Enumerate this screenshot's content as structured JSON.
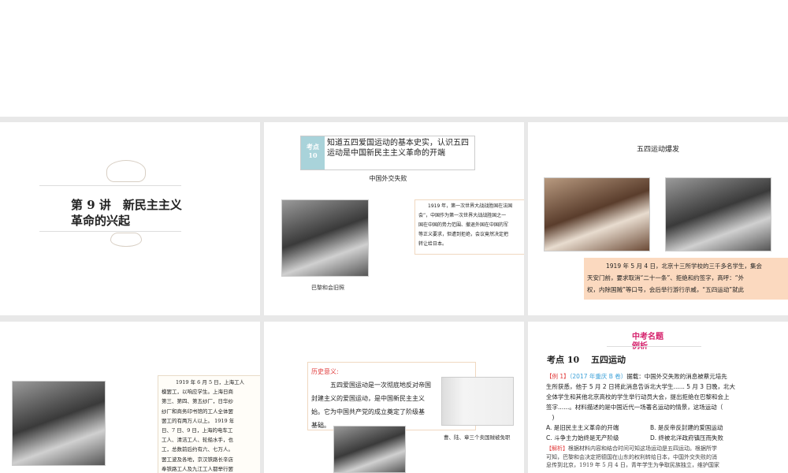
{
  "slides": [
    {
      "title_line1": "第 9 讲　新民主主义",
      "title_line2": "革命的兴起"
    },
    {
      "badge_top": "考点",
      "badge_num": "10",
      "objective": "知道五四爱国运动的基本史实，认识五四运动是中国新民主主义革命的开端",
      "heading": "中国外交失败",
      "photo_caption": "巴黎和会旧照",
      "text": [
        "1919 年，第一次世界大战战胜国在法国",
        "会”，中国作为第一次世界大战战胜国之一",
        "国在中国的势力范围、撤退外国在中国的军",
        "等正义要求，但遭到拒绝，会议竟然决定把",
        "转让给日本。"
      ]
    },
    {
      "heading": "五四运动爆发",
      "text": [
        "1919 年 5 月 4 日，北京十三所学校的三千多名学生，集会",
        "天安门前，要求取消“二十一条”、拒绝和约签字，高呼：“外",
        "权，内除国贼”等口号，会后举行游行示威，“五四运动”就此"
      ]
    },
    {
      "text": [
        "1919 年 6 月 5 日，上海工人",
        "模罢工，以响应学生。上海日商",
        "第三、第四、第五纱厂，日华纱",
        "纱厂和商务印书馆的工人全体罢",
        "罢工的有两万人以上。 1919 年",
        "日、7 日、9 日，上海的电车工",
        "工人、清洁工人、轮船水手，也",
        "工，总数前后约有六、七万人。",
        "罢工波及各地，京汉铁路长辛店",
        "奉铁路工人及九江工人都举行罢"
      ]
    },
    {
      "label": "历史意义:",
      "text": [
        "五四爱国运动是一次彻底地反对帝国",
        "封建主义的爱国运动，是中国新民主主义",
        "始。它为中国共产党的成立奠定了阶级基",
        "基础。"
      ],
      "photo_caption": "曹、陆、章三个卖国贼被免职"
    },
    {
      "banner_line1": "中考名题",
      "banner_line2": "例析",
      "section": "考点 10　 五四运动",
      "example_tag": "【例 1】",
      "example_source": "（2017 年重庆 B 卷）",
      "question": [
        "据载：中国外交失败的消息被蔡元培先",
        "生所获悉，他于 5 月 2 日将此消息告诉北大学生...... 5 月 3 日晚，北大",
        "全体学生和其他北京高校的学生举行动员大会，提出拒绝在巴黎和会上",
        "签字......。材料描述的是中国近代一场著名运动的情景，这场运动（",
        "　)"
      ],
      "options": [
        "A. 是旧民主主义革命的开端",
        "B. 是反帝反封建的爱国运动",
        "C. 斗争主力始终是无产阶级",
        "D. 终被北洋政府镇压而失败"
      ],
      "analysis_tag": "【解析】",
      "analysis": [
        "根据材料内容和结合时间可知这场运动是五四运动。根据所学",
        "可知，巴黎和会决定把德国在山东的权利转给日本，中国外交失败的消",
        "息传到北京，1919 年 5 月 4 日，青年学生为争取民族独立，维护国家"
      ]
    }
  ],
  "colors": {
    "badge": "#a9d3da",
    "accent_red": "#e03a3a",
    "accent_blue": "#3aa0d8",
    "peach": "#fbd9bf",
    "banner": "#d6246e"
  }
}
